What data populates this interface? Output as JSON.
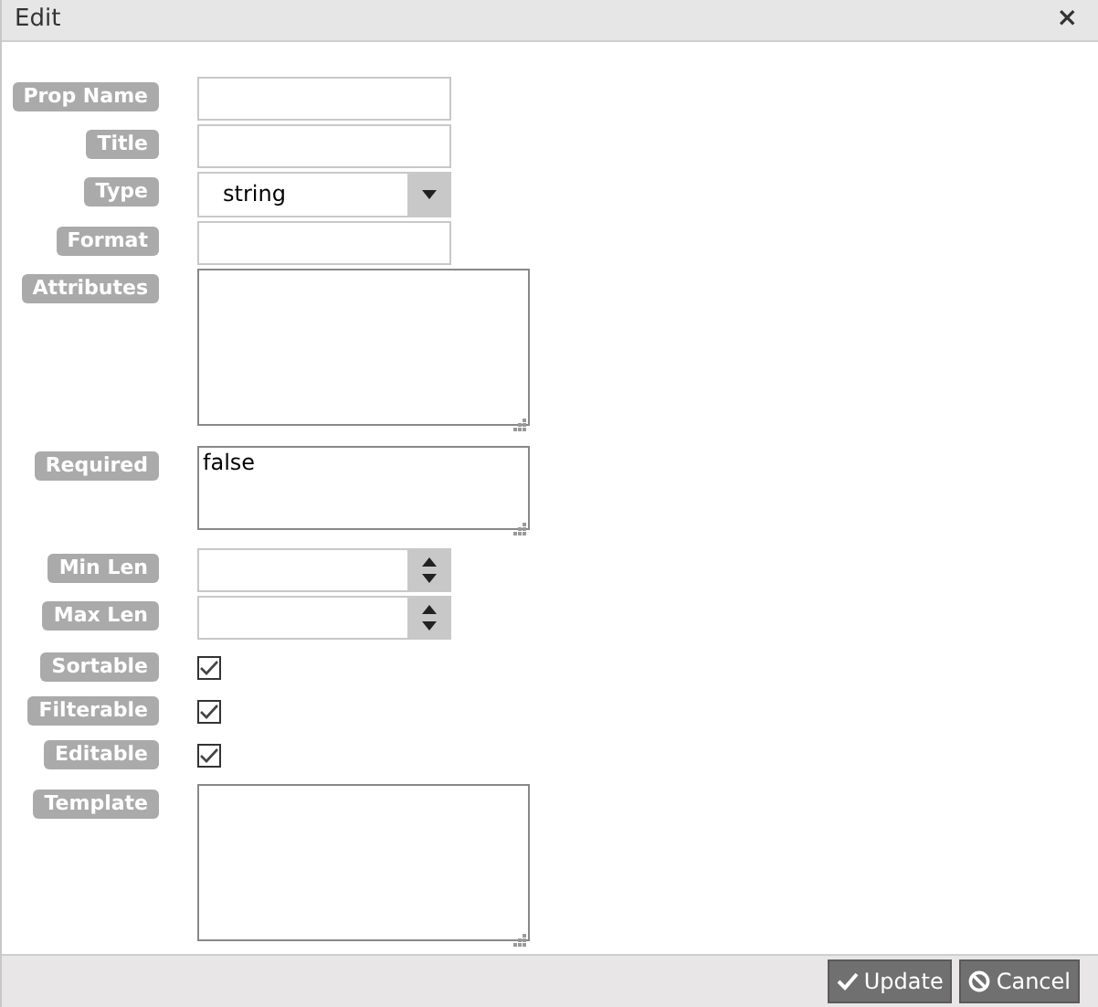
{
  "window": {
    "title": "Edit",
    "close": "×"
  },
  "fields": [
    {
      "label": "Prop Name",
      "kind": "text"
    },
    {
      "label": "Title",
      "kind": "text"
    },
    {
      "label": "Type",
      "kind": "select",
      "value": "string"
    },
    {
      "label": "Format",
      "kind": "text"
    },
    {
      "label": "Attributes",
      "kind": "textarea"
    },
    {
      "label": "Required",
      "kind": "textbox",
      "value": "false"
    },
    {
      "label": "Min Len",
      "kind": "spinner"
    },
    {
      "label": "Max Len",
      "kind": "spinner"
    },
    {
      "label": "Sortable",
      "kind": "checkbox",
      "checked": true
    },
    {
      "label": "Filterable",
      "kind": "checkbox",
      "checked": true
    },
    {
      "label": "Editable",
      "kind": "checkbox",
      "checked": true
    },
    {
      "label": "Template",
      "kind": "textarea"
    }
  ],
  "buttons": [
    {
      "label": "Update",
      "kind": "update"
    },
    {
      "label": "Cancel",
      "kind": "cancel"
    }
  ]
}
